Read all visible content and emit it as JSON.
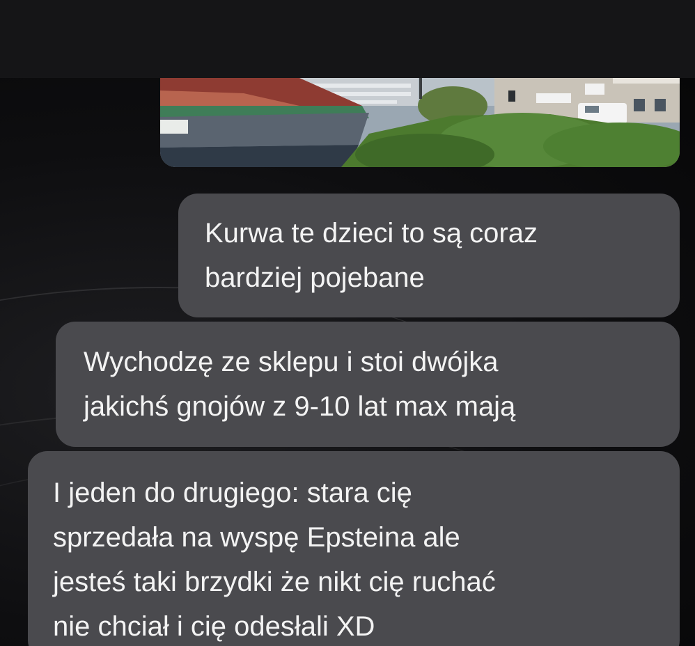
{
  "messages": [
    {
      "lines": [
        "Kurwa te dzieci to są coraz",
        "bardziej pojebane"
      ]
    },
    {
      "lines": [
        "Wychodzę ze sklepu i stoi dwójka",
        "jakichś gnojów z 9-10 lat max mają"
      ]
    },
    {
      "lines": [
        "I jeden do drugiego: stara cię",
        "sprzedała na wyspę Epsteina ale",
        "jesteś taki brzydki że nikt cię ruchać",
        "nie chciał i cię odesłali XD"
      ]
    }
  ],
  "colors": {
    "top_bar": "#151517",
    "bubble": "#4a4a4e",
    "bubble_text": "#f3f3f3"
  },
  "icons": {
    "photo": "photo-attachment"
  }
}
